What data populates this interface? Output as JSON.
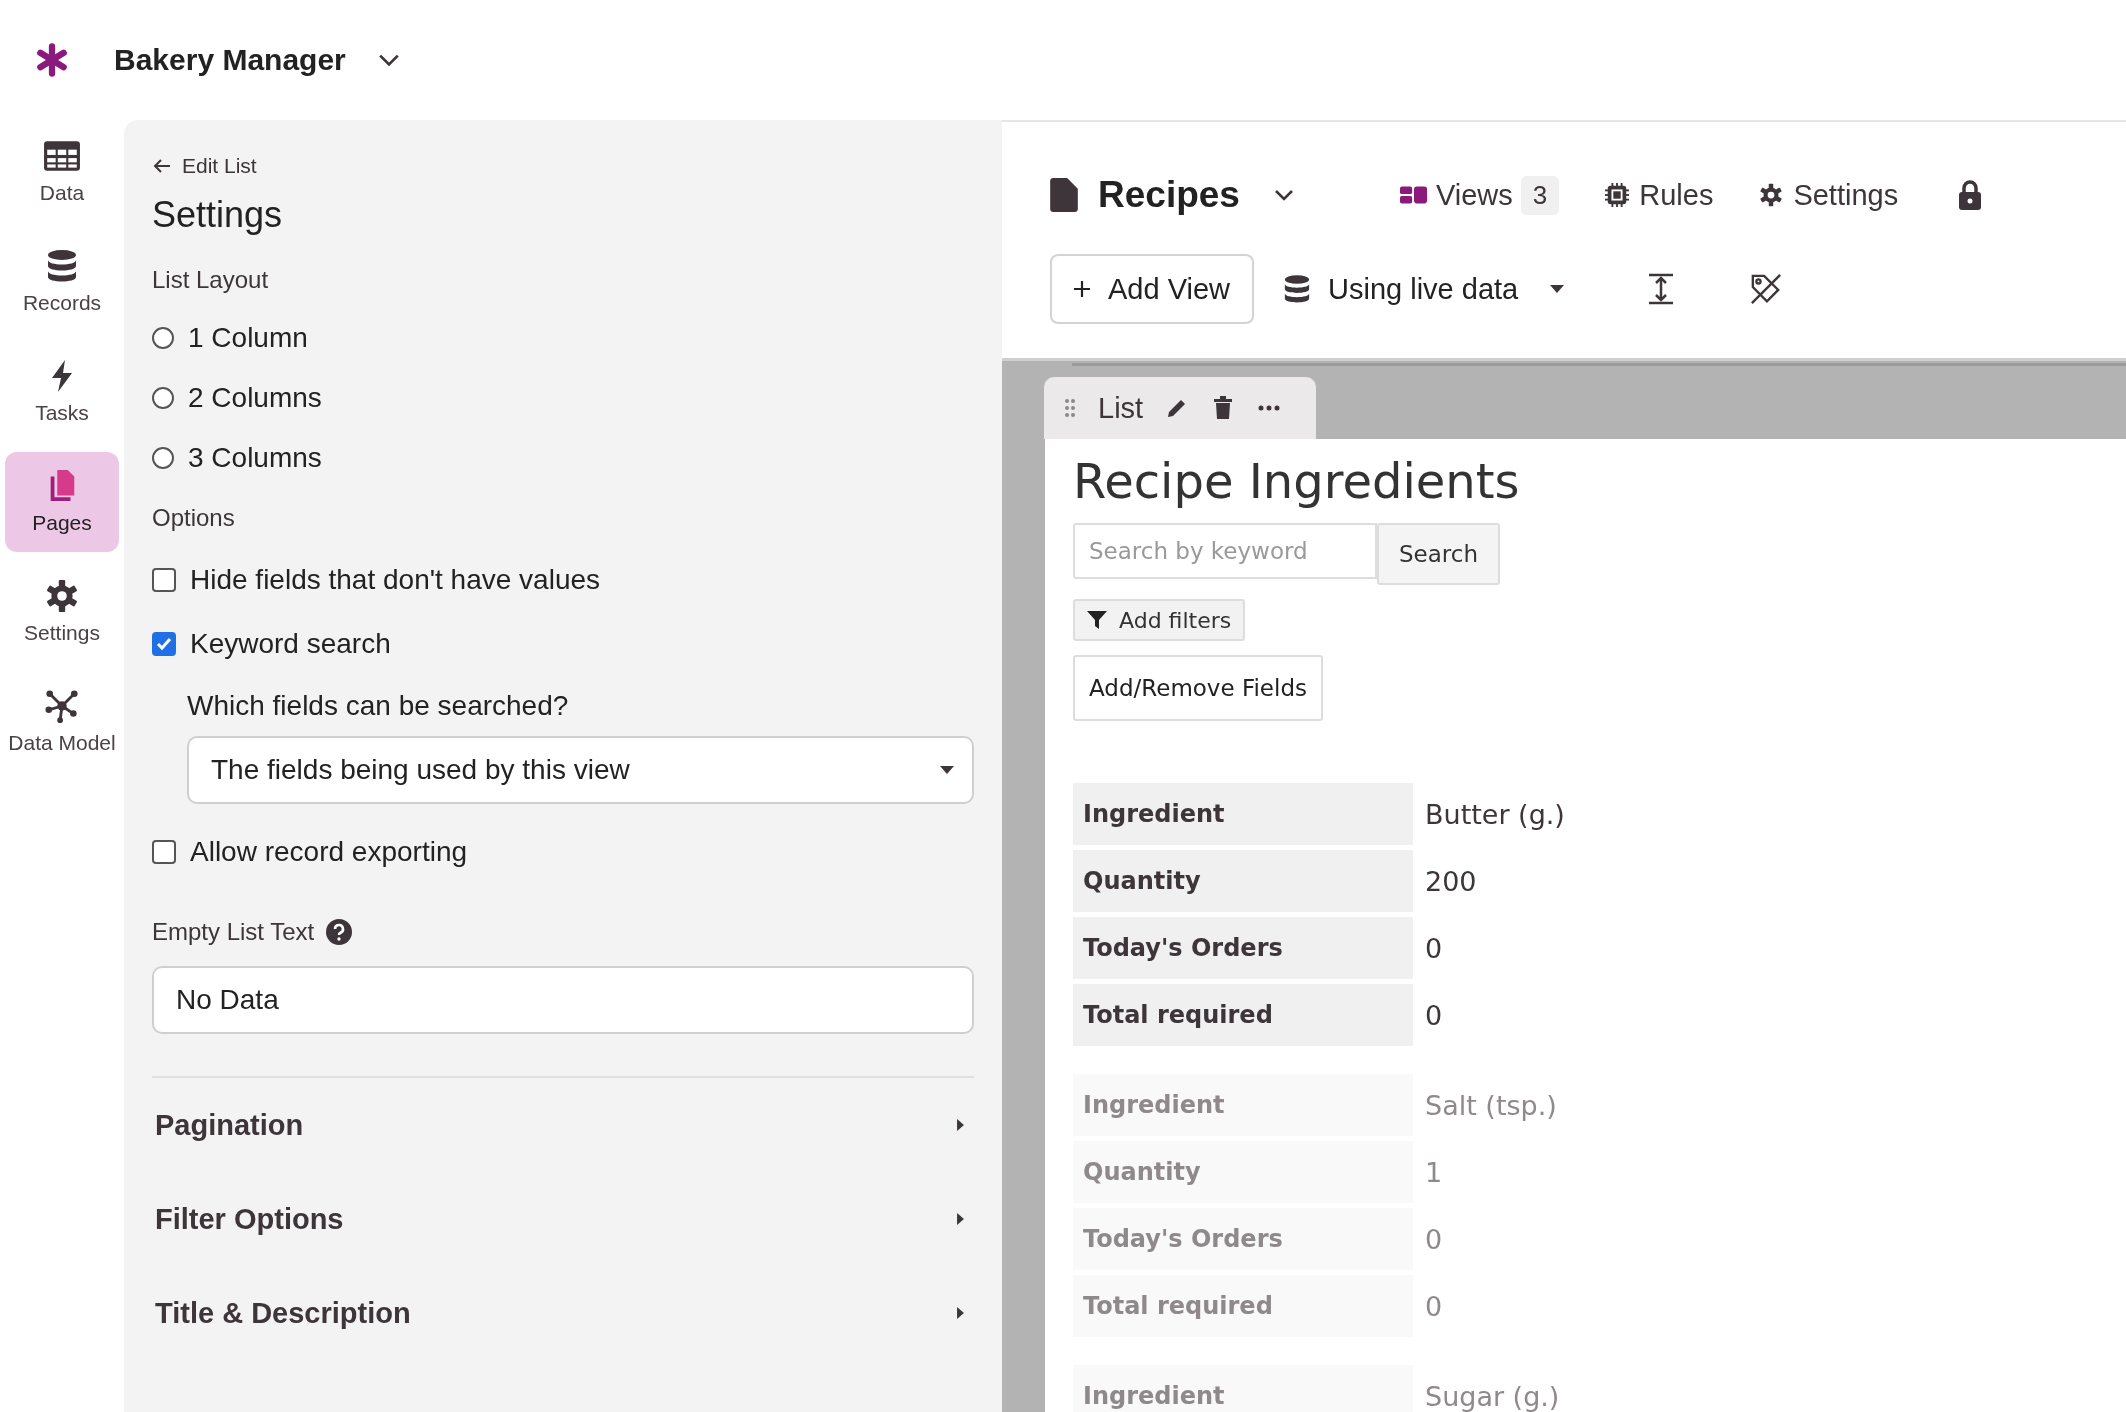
{
  "app": {
    "name": "Bakery Manager"
  },
  "nav": [
    {
      "label": "Data",
      "selected": false
    },
    {
      "label": "Records",
      "selected": false
    },
    {
      "label": "Tasks",
      "selected": false
    },
    {
      "label": "Pages",
      "selected": true
    },
    {
      "label": "Settings",
      "selected": false
    },
    {
      "label": "Data Model",
      "selected": false
    }
  ],
  "panel": {
    "back_link": "Edit List",
    "title": "Settings",
    "layout": {
      "label": "List Layout",
      "options": [
        {
          "label": "1 Column",
          "selected": false
        },
        {
          "label": "2 Columns",
          "selected": false
        },
        {
          "label": "3 Columns",
          "selected": false
        }
      ]
    },
    "options": {
      "label": "Options",
      "checkboxes": [
        {
          "label": "Hide fields that don't have values",
          "checked": false
        },
        {
          "label": "Keyword search",
          "checked": true,
          "sub": {
            "label": "Which fields can be searched?",
            "value": "The fields being used by this view"
          }
        },
        {
          "label": "Allow record exporting",
          "checked": false
        }
      ]
    },
    "empty_text": {
      "label": "Empty List Text",
      "value": "No Data"
    },
    "sections": [
      {
        "label": "Pagination",
        "expanded": false
      },
      {
        "label": "Filter Options",
        "expanded": false
      },
      {
        "label": "Title & Description",
        "expanded": false
      }
    ]
  },
  "header": {
    "page_title": "Recipes",
    "tabs": [
      {
        "kind": "views",
        "label": "Views",
        "count": "3"
      },
      {
        "kind": "rules",
        "label": "Rules"
      },
      {
        "kind": "settings",
        "label": "Settings"
      }
    ],
    "add_view": "Add View",
    "data_source": "Using live data"
  },
  "view": {
    "tab_label": "List",
    "title": "Recipe Ingredients",
    "search_placeholder": "Search by keyword",
    "search_button": "Search",
    "add_filters": "Add filters",
    "add_remove_fields": "Add/Remove Fields",
    "records": [
      {
        "dimmed": false,
        "fields": [
          {
            "label": "Ingredient",
            "value": "Butter (g.)"
          },
          {
            "label": "Quantity",
            "value": "200"
          },
          {
            "label": "Today's Orders",
            "value": "0"
          },
          {
            "label": "Total required",
            "value": "0"
          }
        ]
      },
      {
        "dimmed": true,
        "fields": [
          {
            "label": "Ingredient",
            "value": "Salt (tsp.)"
          },
          {
            "label": "Quantity",
            "value": "1"
          },
          {
            "label": "Today's Orders",
            "value": "0"
          },
          {
            "label": "Total required",
            "value": "0"
          }
        ]
      },
      {
        "dimmed": true,
        "fields": [
          {
            "label": "Ingredient",
            "value": "Sugar (g.)"
          }
        ]
      }
    ]
  }
}
